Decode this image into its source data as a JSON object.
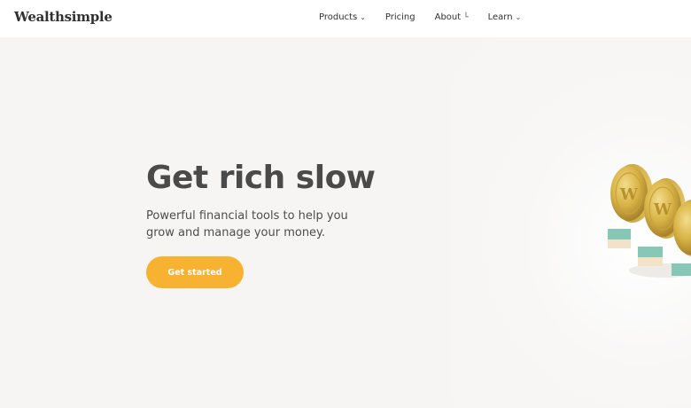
{
  "brand": {
    "logo_text": "Wealthsimple"
  },
  "nav": {
    "items": [
      {
        "label": "Products",
        "has_dropdown": true
      },
      {
        "label": "Pricing",
        "has_dropdown": false
      },
      {
        "label": "About",
        "has_dropdown": true
      },
      {
        "label": "Learn",
        "has_dropdown": true
      }
    ]
  },
  "hero": {
    "title": "Get rich slow",
    "subtitle": "Powerful financial tools to help you grow and manage your money.",
    "cta_label": "Get started"
  },
  "colors": {
    "accent": "#f8b232",
    "background": "#f7f5f3",
    "header_bg": "#ffffff",
    "text_dark": "#4a4a4a"
  },
  "icons": {
    "dropdown": "chevron-down-icon",
    "about_marker": "corner-icon",
    "illustration": "gold-coins-illustration"
  }
}
